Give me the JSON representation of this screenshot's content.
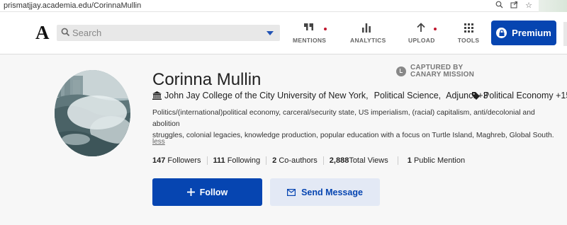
{
  "browser": {
    "url": "prismatjjay.academia.edu/CorinnaMullin",
    "icons": [
      "zoom-icon",
      "share-icon",
      "star-icon"
    ]
  },
  "header": {
    "logo": "A",
    "search": {
      "placeholder": "Search",
      "value": ""
    },
    "nav": [
      {
        "label": "MENTIONS",
        "icon": "quote-icon",
        "notification": true
      },
      {
        "label": "ANALYTICS",
        "icon": "bar-chart-icon",
        "notification": false
      },
      {
        "label": "UPLOAD",
        "icon": "upload-arrow-icon",
        "notification": true
      },
      {
        "label": "TOOLS",
        "icon": "grid-icon",
        "notification": false
      }
    ],
    "premium_label": "Premium"
  },
  "profile": {
    "name": "Corinna Mullin",
    "watermark": {
      "line1": "CAPTURED BY",
      "line2": "CANARY MISSION"
    },
    "institution": "John Jay College of the City University of New York,",
    "department": "Political Science,",
    "role": "Adjunct +3",
    "tag": "Political Economy +15",
    "bio_line1": "Politics/(international)political economy, carceral/security state, US imperialism, (racial) capitalism, anti/decolonial and abolition",
    "bio_line2": "struggles, colonial legacies, knowledge production, popular education with a focus on Turtle Island, Maghreb, Global South.",
    "less_label": "less",
    "stats": {
      "followers_count": "147",
      "followers_label": "Followers",
      "following_count": "111",
      "following_label": "Following",
      "coauthors_count": "2",
      "coauthors_label": "Co-authors",
      "views_count": "2,888",
      "views_label": "Total Views",
      "mentions_count": "1",
      "mentions_label": "Public Mention"
    },
    "follow_label": "Follow",
    "message_label": "Send Message"
  },
  "colors": {
    "brand_blue": "#0645b1",
    "notification_red": "#c0182f",
    "message_button_bg": "#e3e9f5"
  }
}
